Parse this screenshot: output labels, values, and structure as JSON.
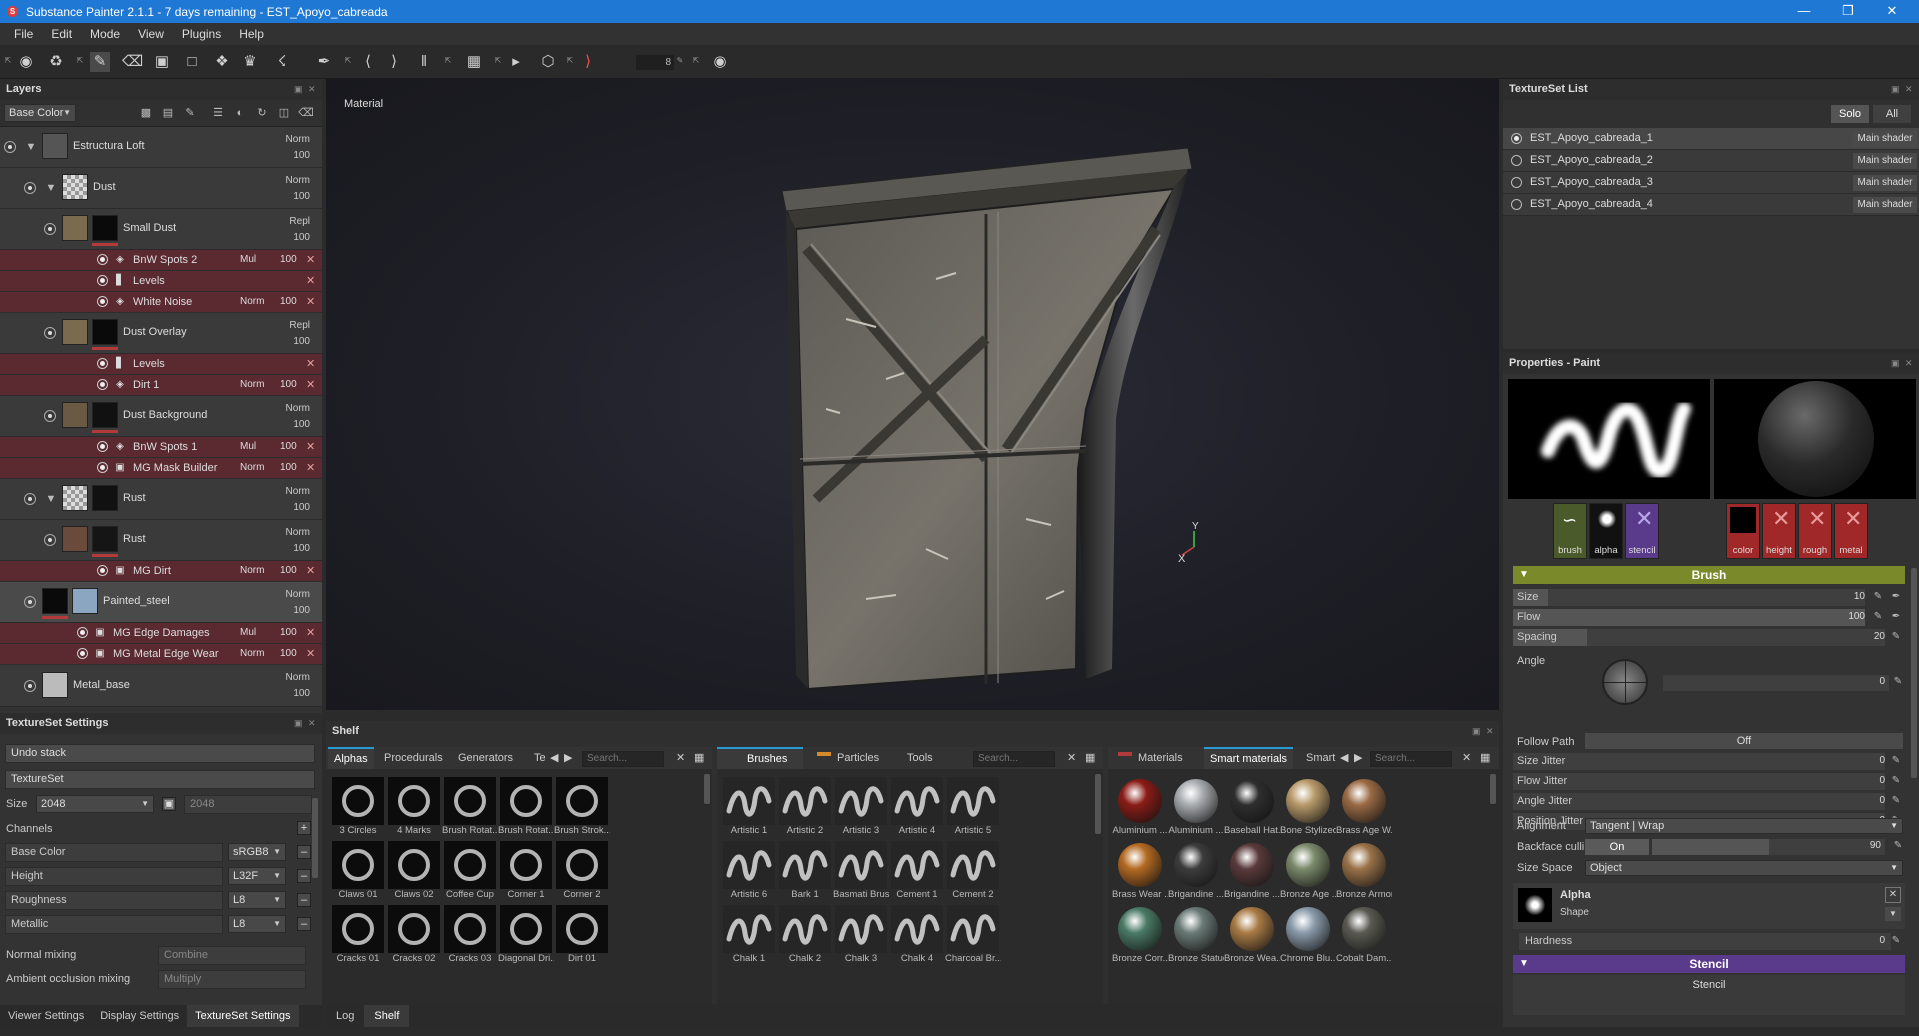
{
  "window": {
    "title": "Substance Painter 2.1.1 - 7 days remaining - EST_Apoyo_cabreada"
  },
  "menu": [
    "File",
    "Edit",
    "Mode",
    "View",
    "Plugins",
    "Help"
  ],
  "toolbar": {
    "brush_count": "8"
  },
  "layers": {
    "title": "Layers",
    "channel_select": "Base Color",
    "items": [
      {
        "name": "Estructura Loft",
        "blend": "Norm",
        "opacity": "100"
      },
      {
        "name": "Dust",
        "blend": "Norm",
        "opacity": "100"
      },
      {
        "name": "Small Dust",
        "blend": "Repl",
        "opacity": "100"
      },
      {
        "name": "Dust Overlay",
        "blend": "Repl",
        "opacity": "100"
      },
      {
        "name": "Dust Background",
        "blend": "Norm",
        "opacity": "100"
      },
      {
        "name": "Rust",
        "blend": "Norm",
        "opacity": "100"
      },
      {
        "name": "Rust",
        "blend": "Norm",
        "opacity": "100"
      },
      {
        "name": "Painted_steel",
        "blend": "Norm",
        "opacity": "100"
      },
      {
        "name": "Metal_base",
        "blend": "Norm",
        "opacity": "100"
      }
    ],
    "effects": [
      {
        "name": "BnW Spots 2",
        "blend": "Mul",
        "opacity": "100"
      },
      {
        "name": "Levels",
        "blend": "",
        "opacity": ""
      },
      {
        "name": "White Noise",
        "blend": "Norm",
        "opacity": "100"
      },
      {
        "name": "Levels",
        "blend": "",
        "opacity": ""
      },
      {
        "name": "Dirt 1",
        "blend": "Norm",
        "opacity": "100"
      },
      {
        "name": "BnW Spots 1",
        "blend": "Mul",
        "opacity": "100"
      },
      {
        "name": "MG Mask Builder",
        "blend": "Norm",
        "opacity": "100"
      },
      {
        "name": "MG Dirt",
        "blend": "Norm",
        "opacity": "100"
      },
      {
        "name": "MG Edge Damages",
        "blend": "Mul",
        "opacity": "100"
      },
      {
        "name": "MG Metal Edge Wear",
        "blend": "Norm",
        "opacity": "100"
      }
    ]
  },
  "textureset_settings": {
    "title": "TextureSet Settings",
    "undo_stack": "Undo stack",
    "textureset": "TextureSet",
    "size_label": "Size",
    "size_value": "2048",
    "size_linked": "2048",
    "channels_label": "Channels",
    "channels": [
      {
        "name": "Base Color",
        "format": "sRGB8"
      },
      {
        "name": "Height",
        "format": "L32F"
      },
      {
        "name": "Roughness",
        "format": "L8"
      },
      {
        "name": "Metallic",
        "format": "L8"
      }
    ],
    "normal_mixing_label": "Normal mixing",
    "normal_mixing_value": "Combine",
    "ao_mixing_label": "Ambient occlusion mixing",
    "ao_mixing_value": "Multiply"
  },
  "bottom_tabs_left": [
    "Viewer Settings",
    "Display Settings",
    "TextureSet Settings"
  ],
  "viewport": {
    "label": "Material",
    "axis_y": "Y",
    "axis_x": "X"
  },
  "shelf": {
    "title": "Shelf",
    "sec1_tabs": [
      "Alphas",
      "Procedurals",
      "Generators",
      "Te"
    ],
    "sec2_tabs": [
      "Brushes",
      "Particles",
      "Tools"
    ],
    "sec3_tabs": [
      "Materials",
      "Smart materials",
      "Smart"
    ],
    "search_placeholder": "Search...",
    "alphas": [
      "3 Circles",
      "4 Marks",
      "Brush Rotat...",
      "Brush Rotat...",
      "Brush Strok...",
      "Claws 01",
      "Claws 02",
      "Coffee Cup",
      "Corner 1",
      "Corner 2",
      "Cracks 01",
      "Cracks 02",
      "Cracks 03",
      "Diagonal Dri...",
      "Dirt 01"
    ],
    "brushes": [
      "Artistic 1",
      "Artistic 2",
      "Artistic 3",
      "Artistic 4",
      "Artistic 5",
      "Artistic 6",
      "Bark 1",
      "Basmati Brush",
      "Cement 1",
      "Cement 2",
      "Chalk 1",
      "Chalk 2",
      "Chalk 3",
      "Chalk 4",
      "Charcoal Br..."
    ],
    "materials": [
      {
        "name": "Aluminium ...",
        "color": "#8a1c16"
      },
      {
        "name": "Aluminium ...",
        "color": "#a8acb0"
      },
      {
        "name": "Baseball Hat...",
        "color": "#2e2e2e"
      },
      {
        "name": "Bone Stylized",
        "color": "#b89a6a"
      },
      {
        "name": "Brass Age W...",
        "color": "#9a6a44"
      },
      {
        "name": "Brass Wear ...",
        "color": "#b46a22"
      },
      {
        "name": "Brigandine ...",
        "color": "#3c3c3c"
      },
      {
        "name": "Brigandine ...",
        "color": "#5a3a3a"
      },
      {
        "name": "Bronze Age ...",
        "color": "#7a8a6a"
      },
      {
        "name": "Bronze Armor",
        "color": "#9a7248"
      },
      {
        "name": "Bronze Corr...",
        "color": "#4a7a66"
      },
      {
        "name": "Bronze Statue...",
        "color": "#6a7a76"
      },
      {
        "name": "Bronze Wea...",
        "color": "#a87a44"
      },
      {
        "name": "Chrome Blu...",
        "color": "#8a9aaa"
      },
      {
        "name": "Cobalt Dam...",
        "color": "#5a5a52"
      }
    ]
  },
  "bottom_tabs_center": [
    "Log",
    "Shelf"
  ],
  "textureset_list": {
    "title": "TextureSet List",
    "solo": "Solo",
    "all": "All",
    "items": [
      {
        "name": "EST_Apoyo_cabreada_1",
        "shader": "Main shader"
      },
      {
        "name": "EST_Apoyo_cabreada_2",
        "shader": "Main shader"
      },
      {
        "name": "EST_Apoyo_cabreada_3",
        "shader": "Main shader"
      },
      {
        "name": "EST_Apoyo_cabreada_4",
        "shader": "Main shader"
      }
    ]
  },
  "properties": {
    "title": "Properties - Paint",
    "tools": [
      "brush",
      "alpha",
      "stencil"
    ],
    "channels": [
      "color",
      "height",
      "rough",
      "metal"
    ],
    "brush_section": "Brush",
    "size": {
      "label": "Size",
      "value": "10",
      "fraction": 0.1
    },
    "flow": {
      "label": "Flow",
      "value": "100",
      "fraction": 1.0
    },
    "spacing": {
      "label": "Spacing",
      "value": "20",
      "fraction": 0.2
    },
    "angle": {
      "label": "Angle",
      "value": "0"
    },
    "follow_path": {
      "label": "Follow Path",
      "value": "Off"
    },
    "size_jitter": {
      "label": "Size Jitter",
      "value": "0"
    },
    "flow_jitter": {
      "label": "Flow Jitter",
      "value": "0"
    },
    "angle_jitter": {
      "label": "Angle Jitter",
      "value": "0"
    },
    "position_jitter": {
      "label": "Position Jitter",
      "value": "0"
    },
    "alignment": {
      "label": "Alignment",
      "value": "Tangent | Wrap"
    },
    "backface": {
      "label": "Backface culling",
      "toggle": "On",
      "value": "90",
      "fraction": 0.5
    },
    "size_space": {
      "label": "Size Space",
      "value": "Object"
    },
    "alpha_title": "Alpha",
    "alpha_shape": "Shape",
    "hardness": {
      "label": "Hardness",
      "value": "0"
    },
    "stencil_section": "Stencil",
    "stencil_label": "Stencil"
  },
  "colors": {
    "accent": "#2a9ad4",
    "brush_bar": "#7a8a2a",
    "stencil_bar": "#5a3a8a",
    "effect_row": "#5a2a30",
    "titlebar": "#1e78d4"
  }
}
